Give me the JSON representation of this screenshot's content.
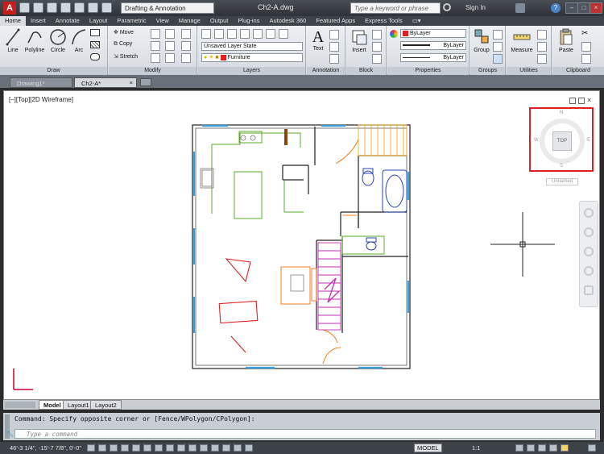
{
  "app": {
    "file_title": "Ch2-A.dwg",
    "workspace": "Drafting & Annotation",
    "search_placeholder": "Type a keyword or phrase",
    "sign_in": "Sign In"
  },
  "ribbon_tabs": [
    "Home",
    "Insert",
    "Annotate",
    "Layout",
    "Parametric",
    "View",
    "Manage",
    "Output",
    "Plug-ins",
    "Autodesk 360",
    "Featured Apps",
    "Express Tools"
  ],
  "panels": {
    "draw": {
      "title": "Draw",
      "tools": [
        "Line",
        "Polyline",
        "Circle",
        "Arc"
      ]
    },
    "modify": {
      "title": "Modify",
      "tools": [
        "Move",
        "Copy",
        "Stretch"
      ]
    },
    "layers": {
      "title": "Layers",
      "layer_state": "Unsaved Layer State",
      "current_layer": "Furniture"
    },
    "annotation": {
      "title": "Annotation",
      "text": "Text"
    },
    "block": {
      "title": "Block",
      "insert": "Insert"
    },
    "properties": {
      "title": "Properties",
      "color": "ByLayer",
      "linetype": "ByLayer",
      "lineweight": "ByLayer"
    },
    "groups": {
      "title": "Groups",
      "group": "Group"
    },
    "utilities": {
      "title": "Utilities",
      "measure": "Measure"
    },
    "clipboard": {
      "title": "Clipboard",
      "paste": "Paste"
    }
  },
  "doc_tabs": [
    "Drawing1*",
    "Ch2-A*"
  ],
  "viewport_label": "[–][Top][2D Wireframe]",
  "viewcube": {
    "face": "TOP",
    "n": "N",
    "s": "S",
    "e": "E",
    "w": "W",
    "wcs": "Unnamed"
  },
  "layout_tabs": [
    "Model",
    "Layout1",
    "Layout2"
  ],
  "command": {
    "history": "Command: Specify opposite corner or [Fence/WPolygon/CPolygon]:",
    "prompt": "Type a command"
  },
  "status": {
    "coordinates": "46'-3 1/4\", -15'-7 7/8\", 0'-0\"",
    "model": "MODEL",
    "scale": "1:1"
  },
  "colors": {
    "accent": "#d62b2b",
    "viewcube_border": "#e02020"
  }
}
